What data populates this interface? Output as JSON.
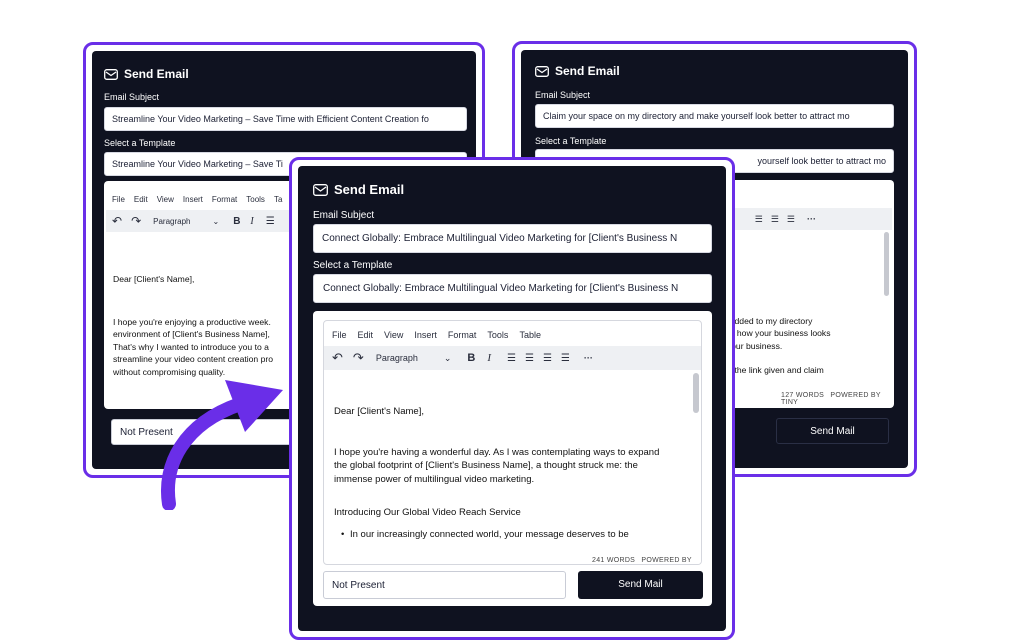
{
  "common": {
    "title": "Send Email",
    "subject_label": "Email Subject",
    "template_label": "Select a Template",
    "send_label": "Send Mail",
    "status_placeholder": "Not Present",
    "paragraph_label": "Paragraph",
    "powered": "POWERED BY TINY"
  },
  "menu": [
    "File",
    "Edit",
    "View",
    "Insert",
    "Format",
    "Tools",
    "Table"
  ],
  "menu_left_visible": [
    "File",
    "Edit",
    "View",
    "Insert",
    "Format",
    "Tools",
    "Ta"
  ],
  "left_card": {
    "subject": "Streamline Your Video Marketing – Save Time with Efficient Content Creation fo",
    "template": "Streamline Your Video Marketing – Save Ti",
    "greeting": "Dear [Client's Name],",
    "lines": [
      "I hope you're enjoying a productive week.",
      "environment of [Client's Business Name],",
      "That's why I wanted to introduce you to a",
      "streamline your video content creation pro",
      "without compromising quality."
    ]
  },
  "right_card": {
    "subject": "Claim your space on my directory and make yourself look better to attract mo",
    "template": "yourself look better to attract mo",
    "lines": [
      "ry",
      "een added to my directory",
      "ontrol how your business looks",
      "ost your business.",
      "go to the link given and claim"
    ],
    "word_count": "127 WORDS"
  },
  "front_card": {
    "subject": "Connect Globally: Embrace Multilingual Video Marketing for [Client's Business N",
    "template": "Connect Globally: Embrace Multilingual Video Marketing for [Client's Business N",
    "greeting": "Dear [Client's Name],",
    "para1": [
      "I hope you're having a wonderful day. As I was contemplating ways to expand",
      "the global footprint of [Client's Business Name], a thought struck me: the",
      "immense power of multilingual video marketing."
    ],
    "heading": "Introducing Our Global Video Reach Service",
    "bullet": "In our increasingly connected world, your message deserves to be",
    "word_count": "241 WORDS"
  },
  "colors": {
    "accent": "#6a2ee8",
    "panel": "#0f1220"
  },
  "icons": [
    "envelope-icon",
    "undo-icon",
    "redo-icon",
    "chevron-down-icon",
    "bold-icon",
    "italic-icon",
    "align-left-icon",
    "align-center-icon",
    "align-right-icon",
    "justify-icon",
    "more-icon",
    "resize-icon",
    "curved-arrow-icon"
  ]
}
